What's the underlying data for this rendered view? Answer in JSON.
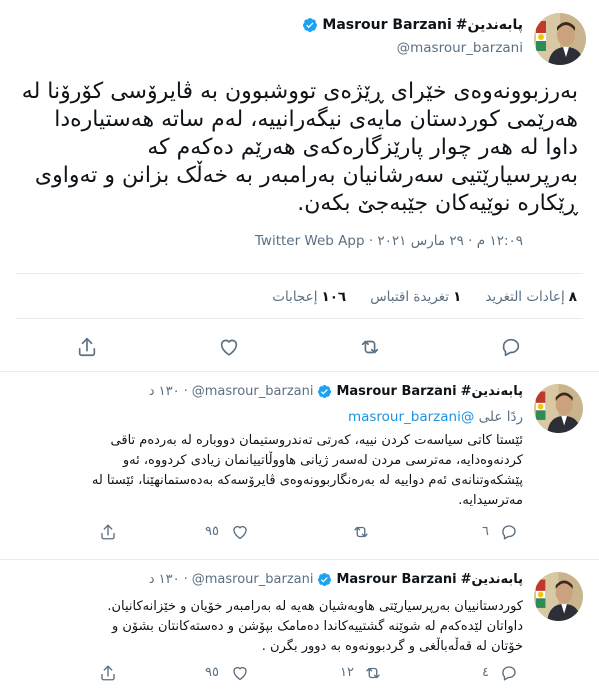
{
  "main_tweet": {
    "display_name": "Masrour Barzani",
    "prefix": "#پابەندین",
    "handle": "@masrour_barzani",
    "text_lines": [
      "بەرزبوونەوەی خێرای ڕێژەی تووشبوون بە ڤایرۆسی کۆرۆنا لە",
      "هەرێمی کوردستان مایەی نیگەرانییە، لەم ساتە هەستیارەدا",
      "داوا لە هەر چوار پارێزگارەکەی هەرێم دەکەم کە",
      "بەرپرسیارێتیی سەرشانیان بەرامبەر بە خەڵک بزانن و تەواوی",
      "ڕێکارە نوێیەکان جێبەجێ بکەن."
    ],
    "time": "١٢:٠٩ م",
    "date": "٢٩ مارس ٢٠٢١",
    "source": "Twitter Web App",
    "stats": {
      "retweets_count": "٨",
      "retweets_label": "إعادات التغريد",
      "quotes_count": "١",
      "quotes_label": "تغريدة اقتباس",
      "likes_count": "١٠٦",
      "likes_label": "إعجابات"
    }
  },
  "replies": [
    {
      "display_name": "Masrour Barzani",
      "prefix": "#پابەندین",
      "handle": "@masrour_barzani",
      "age": "١٣٠ د",
      "replying_label": "ردًا على",
      "replying_handle": "@masrour_barzani",
      "text_lines": [
        "ئێستا کاتی سیاسەت کردن نییە، کەرتی تەندروستیمان دووبارە لە بەردەم تاقی",
        "کردنەوەدایە، مەترسی مردن لەسەر ژیانی هاووڵاتییانمان زیادی کردووە، ئەو",
        "پێشکەوتنانەی ئەم دواییە لە بەرەنگاربوونەوەی ڤایرۆسەکە بەدەستمانهێنا، ئێستا لە",
        "مەترسیدایە."
      ],
      "reply_count": "٦",
      "retweet_count": "",
      "like_count": "٩٥"
    },
    {
      "display_name": "Masrour Barzani",
      "prefix": "#پابەندین",
      "handle": "@masrour_barzani",
      "age": "١٣٠ د",
      "text_lines": [
        "کوردستانییان بەرپرسیارێتی هاوبەشیان هەیە لە بەرامبەر خۆیان و خێزانەکانیان.",
        "داواتان لێدەکەم لە شوێنە گشتییەکاندا دەمامک بپۆشن و دەستەکانتان بشۆن و",
        "خۆتان لە قەڵەباڵغی و گردبوونەوە بە دوور بگرن ."
      ],
      "reply_count": "٤",
      "retweet_count": "١٢",
      "like_count": "٩٥"
    }
  ],
  "colors": {
    "verified": "#1da1f2",
    "link": "#1b95e0",
    "secondary_text": "#5b7083",
    "divider": "#e6ecf0"
  }
}
